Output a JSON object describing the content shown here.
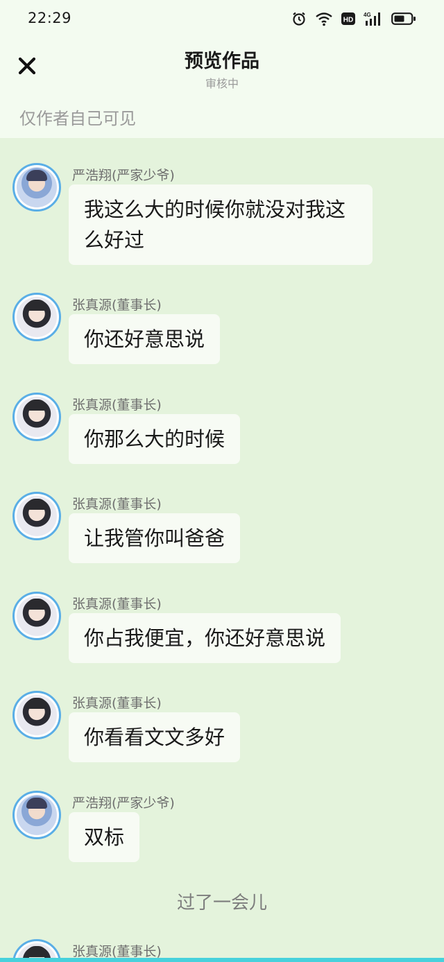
{
  "status_bar": {
    "time": "22:29",
    "icons": [
      "alarm-icon",
      "wifi-icon",
      "hd-icon",
      "signal-4g-icon",
      "battery-icon"
    ],
    "hd_label": "HD",
    "network_label": "4G"
  },
  "header": {
    "title": "预览作品",
    "subtitle": "审核中",
    "visibility_note": "仅作者自己可见",
    "close_icon": "close-icon"
  },
  "messages": [
    {
      "sender": "严浩翔(严家少爷)",
      "text": "我这么大的时候你就没对我这么好过"
    },
    {
      "sender": "张真源(董事长)",
      "text": "你还好意思说"
    },
    {
      "sender": "张真源(董事长)",
      "text": "你那么大的时候"
    },
    {
      "sender": "张真源(董事长)",
      "text": "让我管你叫爸爸"
    },
    {
      "sender": "张真源(董事长)",
      "text": "你占我便宜，你还好意思说"
    },
    {
      "sender": "张真源(董事长)",
      "text": "你看看文文多好"
    },
    {
      "sender": "严浩翔(严家少爷)",
      "text": "双标"
    }
  ],
  "narration": "过了一会儿",
  "last_message": {
    "sender": "张真源(董事长)"
  },
  "colors": {
    "background": "#e4f3dc",
    "header_background": "#f3fbf0",
    "bubble": "#f7fbf4",
    "avatar_ring": "#5aaee6",
    "bottom_accent": "#47d1dc"
  }
}
